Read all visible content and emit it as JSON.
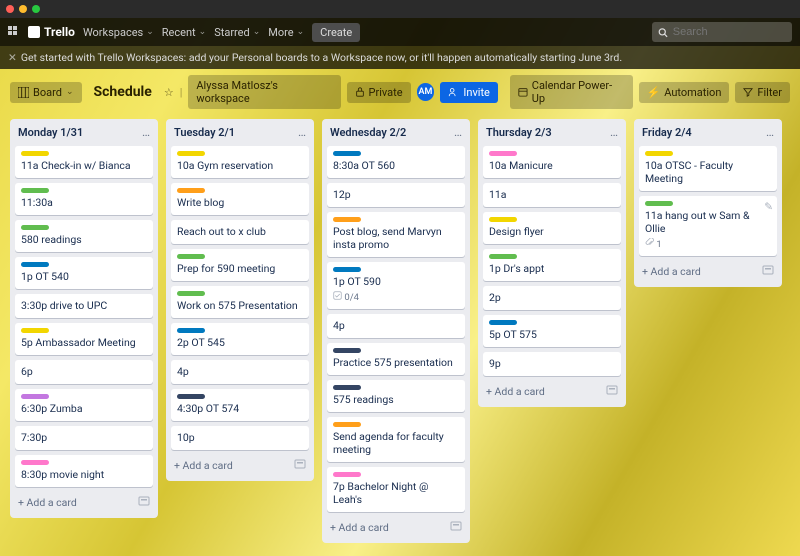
{
  "titlebar": {
    "brand": "Trello"
  },
  "nav": {
    "workspaces": "Workspaces",
    "recent": "Recent",
    "starred": "Starred",
    "more": "More",
    "create": "Create",
    "search_placeholder": "Search"
  },
  "banner": {
    "text": "Get started with Trello Workspaces: add your Personal boards to a Workspace now, or it'll happen automatically starting June 3rd."
  },
  "boardbar": {
    "board_btn": "Board",
    "board_name": "Schedule",
    "workspace": "Alyssa Matlosz's workspace",
    "visibility": "Private",
    "avatar_initials": "AM",
    "invite": "Invite",
    "powerup": "Calendar Power-Up",
    "automation": "Automation",
    "filter": "Filter"
  },
  "lists": [
    {
      "title": "Monday 1/31",
      "cards": [
        {
          "label": "l-yellow",
          "text": "11a Check-in w/ Bianca"
        },
        {
          "label": "l-green",
          "text": "11:30a"
        },
        {
          "label": "l-green",
          "text": "580 readings"
        },
        {
          "label": "l-blue",
          "text": "1p OT 540"
        },
        {
          "text": "3:30p drive to UPC"
        },
        {
          "label": "l-yellow",
          "text": "5p Ambassador Meeting"
        },
        {
          "text": "6p"
        },
        {
          "label": "l-purple",
          "text": "6:30p Zumba"
        },
        {
          "text": "7:30p"
        },
        {
          "label": "l-pink",
          "text": "8:30p movie night"
        }
      ]
    },
    {
      "title": "Tuesday 2/1",
      "cards": [
        {
          "label": "l-yellow",
          "text": "10a Gym reservation"
        },
        {
          "label": "l-orange",
          "text": "Write blog"
        },
        {
          "text": "Reach out to x club"
        },
        {
          "label": "l-green",
          "text": "Prep for 590 meeting"
        },
        {
          "label": "l-green",
          "text": "Work on 575 Presentation"
        },
        {
          "label": "l-blue",
          "text": "2p OT 545"
        },
        {
          "text": "4p"
        },
        {
          "label": "l-navy",
          "text": "4:30p OT 574"
        },
        {
          "text": "10p"
        }
      ]
    },
    {
      "title": "Wednesday 2/2",
      "cards": [
        {
          "label": "l-blue",
          "text": "8:30a OT 560"
        },
        {
          "text": "12p"
        },
        {
          "label": "l-orange",
          "text": "Post blog, send Marvyn insta promo"
        },
        {
          "label": "l-blue",
          "text": "1p OT 590",
          "check": "0/4"
        },
        {
          "text": "4p"
        },
        {
          "label": "l-navy",
          "text": "Practice 575 presentation"
        },
        {
          "label": "l-navy",
          "text": "575 readings"
        },
        {
          "label": "l-orange",
          "text": "Send agenda for faculty meeting"
        },
        {
          "label": "l-pink",
          "text": "7p Bachelor Night @ Leah's"
        }
      ]
    },
    {
      "title": "Thursday 2/3",
      "cards": [
        {
          "label": "l-pink",
          "text": "10a Manicure"
        },
        {
          "text": "11a"
        },
        {
          "label": "l-yellow",
          "text": "Design flyer"
        },
        {
          "label": "l-green",
          "text": "1p Dr's appt"
        },
        {
          "text": "2p"
        },
        {
          "label": "l-blue",
          "text": "5p OT 575"
        },
        {
          "text": "9p"
        }
      ]
    },
    {
      "title": "Friday 2/4",
      "cards": [
        {
          "label": "l-yellow",
          "text": "10a OTSC - Faculty Meeting"
        },
        {
          "label": "l-green",
          "text": "11a hang out w Sam & Ollie",
          "showedit": true,
          "attach": "1"
        }
      ]
    }
  ],
  "addcard_label": "+ Add a card"
}
